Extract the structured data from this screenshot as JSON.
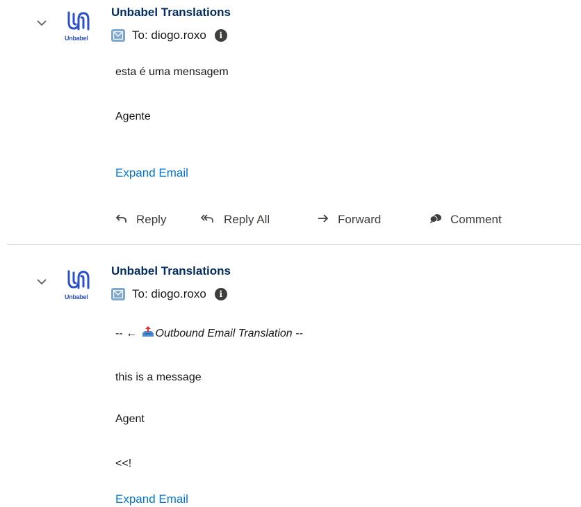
{
  "emails": [
    {
      "sender": "Unbabel Translations",
      "logo_text": "Unbabel",
      "to": "To: diogo.roxo",
      "body": [
        "esta é uma mensagem",
        "Agente"
      ],
      "expand_label": "Expand Email",
      "actions": {
        "reply": "Reply",
        "reply_all": "Reply All",
        "forward": "Forward",
        "comment": "Comment"
      }
    },
    {
      "sender": "Unbabel Translations",
      "logo_text": "Unbabel",
      "to": "To: diogo.roxo",
      "body_prefix": "-- ← ",
      "body_heading": "Outbound Email Translation --",
      "body": [
        "this is a message",
        "Agent",
        "<<!"
      ],
      "expand_label": "Expand Email"
    }
  ],
  "colors": {
    "sender": "#032d60",
    "link": "#0176d3",
    "logo": "#2b50c9",
    "email_icon": "#7ea7cf"
  },
  "icons": {
    "toggle": "chevron-down-icon",
    "logo": "unbabel-logo",
    "to": "email-icon",
    "info": "info-icon",
    "reply": "reply-icon",
    "reply_all": "reply-all-icon",
    "forward": "forward-icon",
    "comment": "comment-icon"
  }
}
